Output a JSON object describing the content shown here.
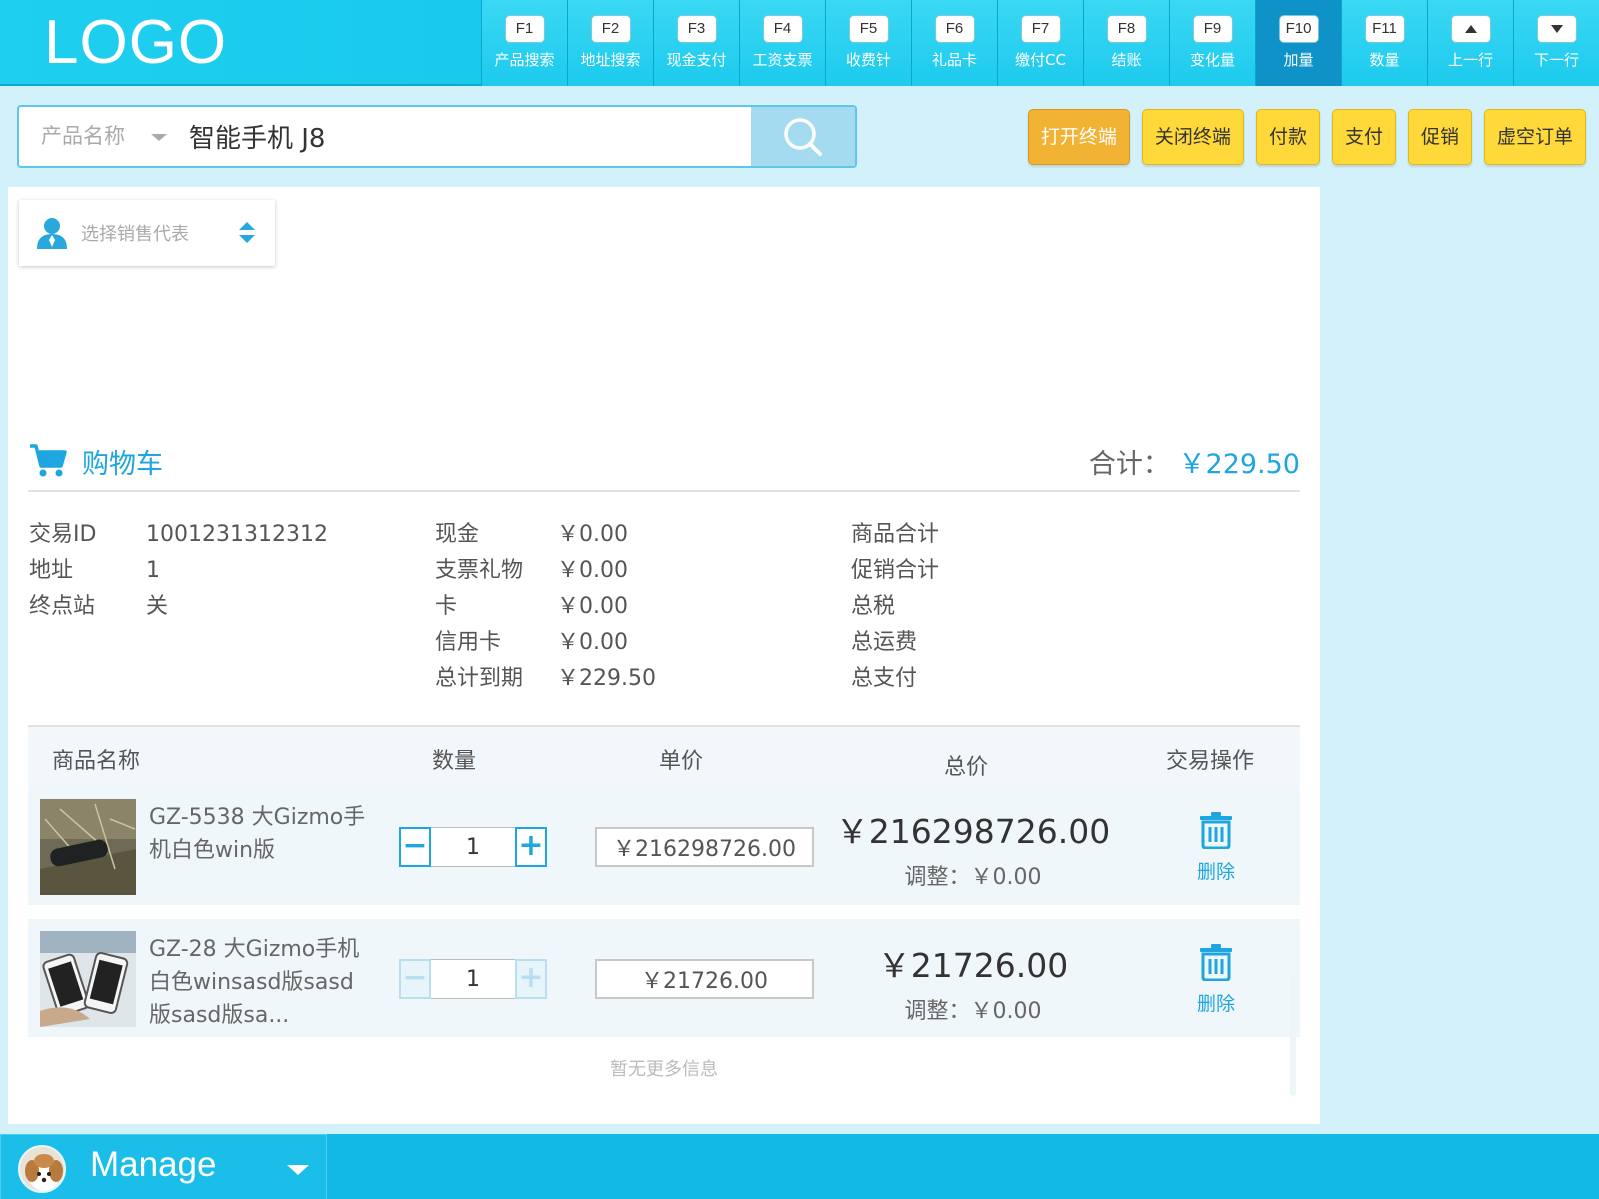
{
  "app": {
    "logo": "LOGO"
  },
  "fkeys": [
    {
      "key": "F1",
      "label": "产品搜索",
      "active": false
    },
    {
      "key": "F2",
      "label": "地址搜索",
      "active": false
    },
    {
      "key": "F3",
      "label": "现金支付",
      "active": false
    },
    {
      "key": "F4",
      "label": "工资支票",
      "active": false
    },
    {
      "key": "F5",
      "label": "收费针",
      "active": false
    },
    {
      "key": "F6",
      "label": "礼品卡",
      "active": false
    },
    {
      "key": "F7",
      "label": "缴付CC",
      "active": false
    },
    {
      "key": "F8",
      "label": "结账",
      "active": false
    },
    {
      "key": "F9",
      "label": "变化量",
      "active": false
    },
    {
      "key": "F10",
      "label": "加量",
      "active": true
    },
    {
      "key": "F11",
      "label": "数量",
      "active": false
    },
    {
      "key": "up-arrow-icon",
      "label": "上一行",
      "active": false
    },
    {
      "key": "down-arrow-icon",
      "label": "下一行",
      "active": false
    }
  ],
  "search": {
    "field_type": "产品名称",
    "value": "智能手机 J8"
  },
  "actions": {
    "open_terminal": "打开终端",
    "close_terminal": "关闭终端",
    "payment": "付款",
    "pay": "支付",
    "promotion": "促销",
    "void_order": "虚空订单"
  },
  "sales_rep": {
    "placeholder": "选择销售代表"
  },
  "cart": {
    "title": "购物车",
    "total_label": "合计：",
    "total_value": "￥229.50"
  },
  "info": {
    "col1": [
      {
        "label": "交易ID",
        "value": "1001231312312"
      },
      {
        "label": "地址",
        "value": "1"
      },
      {
        "label": "终点站",
        "value": "关"
      }
    ],
    "col2": [
      {
        "label": "现金",
        "value": "￥0.00"
      },
      {
        "label": "支票礼物",
        "value": "￥0.00"
      },
      {
        "label": "卡",
        "value": "￥0.00"
      },
      {
        "label": "信用卡",
        "value": "￥0.00"
      },
      {
        "label": "总计到期",
        "value": "￥229.50"
      }
    ],
    "col3": [
      {
        "label": "商品合计"
      },
      {
        "label": "促销合计"
      },
      {
        "label": "总税"
      },
      {
        "label": "总运费"
      },
      {
        "label": "总支付"
      }
    ]
  },
  "table": {
    "headers": {
      "name": "商品名称",
      "qty": "数量",
      "unit_price": "单价",
      "total": "总价",
      "ops": "交易操作"
    },
    "rows": [
      {
        "name": "GZ-5538 大Gizmo手机白色win版",
        "qty": "1",
        "unit_price": "￥216298726.00",
        "total": "￥216298726.00",
        "adjust": "调整：￥0.00",
        "delete": "删除",
        "stepper_disabled": false
      },
      {
        "name": "GZ-28 大Gizmo手机白色winsasd版sasd版sasd版sa...",
        "qty": "1",
        "unit_price": "￥21726.00",
        "total": "￥21726.00",
        "adjust": "调整：￥0.00",
        "delete": "删除",
        "stepper_disabled": true
      }
    ],
    "no_more": "暂无更多信息"
  },
  "user": {
    "name": "Manage"
  },
  "colors": {
    "accent": "#1da6df",
    "topbar": "#12c5ea",
    "action_yellow": "#ffd93a",
    "action_orange": "#f2b233"
  }
}
